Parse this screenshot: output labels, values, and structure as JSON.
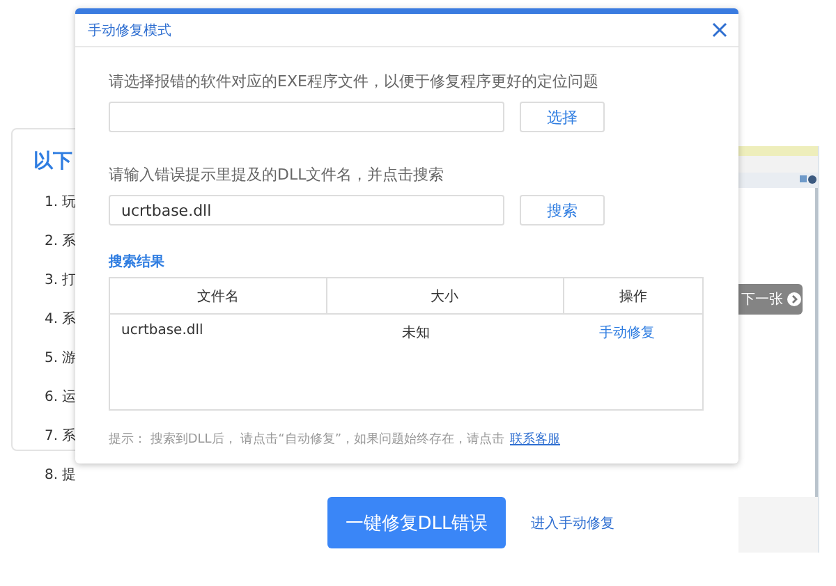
{
  "background_card": {
    "title": "以下",
    "items": [
      "1. 玩",
      "2. 系",
      "3. 打",
      "4. 系",
      "5. 游",
      "6. 运",
      "7. 系",
      "8. 提"
    ]
  },
  "preview": {
    "next_button": "下一张"
  },
  "dialog": {
    "title": "手动修复模式",
    "exe_prompt": "请选择报错的软件对应的EXE程序文件，以便于修复程序更好的定位问题",
    "select_button": "选择",
    "dll_prompt": "请输入错误提示里提及的DLL文件名，并点击搜索",
    "dll_field": {
      "value": "ucrtbase.dll"
    },
    "search_button": "搜索",
    "results_title": "搜索结果",
    "table": {
      "columns": [
        "文件名",
        "大小",
        "操作"
      ],
      "rows": [
        {
          "name": "ucrtbase.dll",
          "size": "未知",
          "action": "手动修复"
        }
      ]
    },
    "hint": "提示： 搜索到DLL后， 请点击“自动修复”，如果问题始终存在，请点击",
    "hint_link": "联系客服"
  },
  "primary_button": "一键修复DLL错误",
  "manual_link": "进入手动修复"
}
